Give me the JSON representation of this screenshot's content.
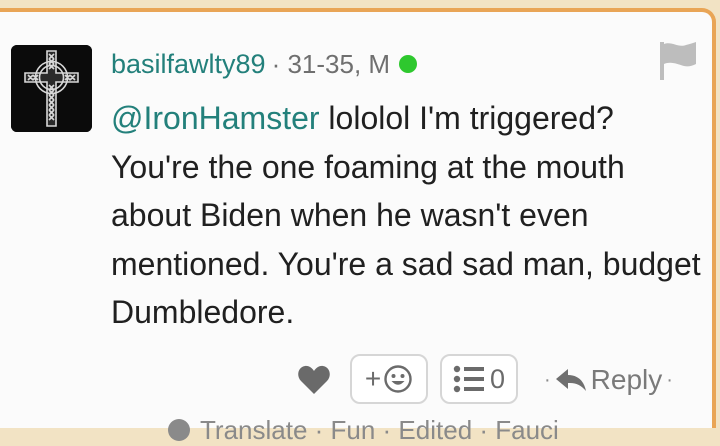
{
  "comment": {
    "username": "basilfawlty89",
    "meta": "· 31-35, M",
    "online": true,
    "mention": "@IronHamster",
    "text": " lololol I'm triggered? You're the one foaming at the mouth about Biden when he wasn't even mentioned. You're a sad sad man, budget Dumbledore."
  },
  "actions": {
    "react_plus": "+",
    "comments_count": "0",
    "separator": "·",
    "reply_label": "Reply"
  },
  "footer": {
    "partial_text": "Translate · Fun · Edited · Fauci"
  },
  "colors": {
    "accent_teal": "#23807b",
    "border_orange": "#e9a556",
    "online_green": "#2ec82e"
  },
  "icons": [
    "celtic-cross-avatar",
    "flag-icon",
    "heart-icon",
    "emoji-icon",
    "list-icon",
    "reply-arrow-icon",
    "translate-icon"
  ]
}
